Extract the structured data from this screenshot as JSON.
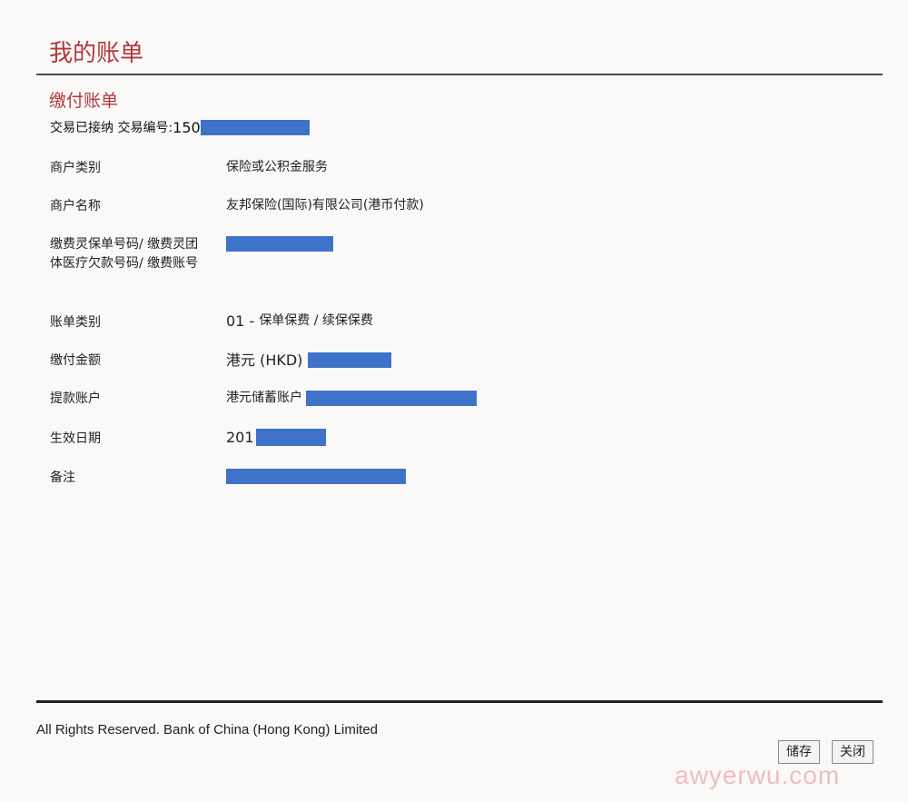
{
  "page": {
    "title": "我的账单"
  },
  "section": {
    "title": "缴付账单",
    "accepted_label": "交易已接纳 交易编号:",
    "accepted_ref_prefix": "150"
  },
  "rows": [
    {
      "label": "商户类别",
      "value": "保险或公积金服务"
    },
    {
      "label": "商户名称",
      "value": "友邦保险(国际)有限公司(港币付款)"
    },
    {
      "label": "缴费灵保单号码/ 缴费灵团体医疗欠款号码/ 缴费账号",
      "value": ""
    },
    {
      "label": "账单类别",
      "value_prefix": "01 - ",
      "value": "保单保费 / 续保保费"
    },
    {
      "label": "缴付金额",
      "value": "港元 (HKD)"
    },
    {
      "label": "提款账户",
      "value": "港元储蓄账户"
    },
    {
      "label": "生效日期",
      "value": "201"
    },
    {
      "label": "备注",
      "value": ""
    }
  ],
  "redaction_color": "#3e73c9",
  "footer": {
    "copyright": "All Rights Reserved. Bank of China (Hong Kong) Limited",
    "save_label": "储存",
    "close_label": "关闭"
  },
  "watermark": "awyerwu.com"
}
